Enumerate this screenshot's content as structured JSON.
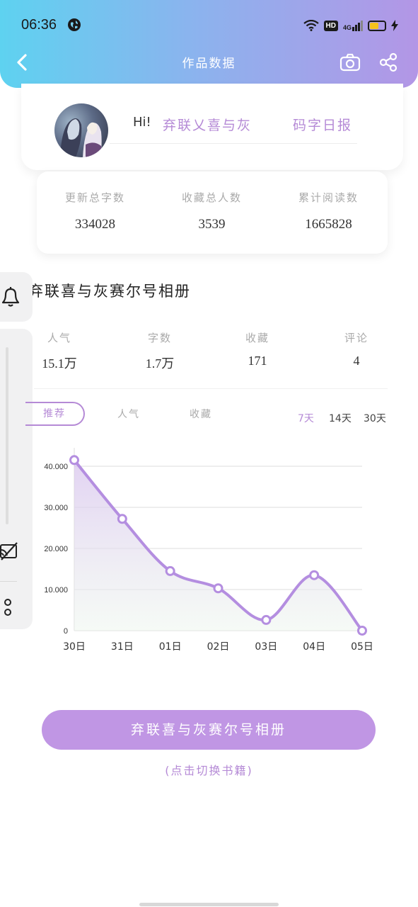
{
  "status_bar": {
    "time": "06:36",
    "hd_label": "HD",
    "network_label": "4G",
    "battery_level": 0.6,
    "battery_color": "#f5c31d"
  },
  "nav": {
    "title": "作品数据",
    "back_icon": "chevron-left-icon",
    "camera_icon": "camera-icon",
    "share_icon": "share-icon"
  },
  "profile": {
    "greeting": "Hi!",
    "author_name": "弃联乂喜与灰",
    "daily_report_link": "码字日报"
  },
  "summary": [
    {
      "label": "更新总字数",
      "value": "334028"
    },
    {
      "label": "收藏总人数",
      "value": "3539"
    },
    {
      "label": "累计阅读数",
      "value": "1665828"
    }
  ],
  "book": {
    "title": "弃联喜与灰赛尔号相册",
    "metrics": [
      {
        "label": "人气",
        "value": "15.1万"
      },
      {
        "label": "字数",
        "value": "1.7万"
      },
      {
        "label": "收藏",
        "value": "171"
      },
      {
        "label": "评论",
        "value": "4"
      }
    ]
  },
  "tabs": [
    {
      "label": "推荐",
      "active": true
    },
    {
      "label": "人气",
      "active": false
    },
    {
      "label": "收藏",
      "active": false
    }
  ],
  "ranges": [
    {
      "label": "7天",
      "active": true
    },
    {
      "label": "14天",
      "active": false
    },
    {
      "label": "30天",
      "active": false
    }
  ],
  "chart_data": {
    "type": "line",
    "categories": [
      "30日",
      "31日",
      "01日",
      "02日",
      "03日",
      "04日",
      "05日"
    ],
    "values": [
      41500,
      27200,
      14500,
      10300,
      2600,
      13500,
      0
    ],
    "y_ticks": [
      "0",
      "10.000",
      "20.000",
      "30.000",
      "40.000"
    ],
    "ylim": [
      0,
      40000
    ],
    "grid": true,
    "line_color": "#b48ee0"
  },
  "switch_button": {
    "label": "弃联喜与灰赛尔号相册",
    "hint": "(点击切换书籍)"
  },
  "side_panel": {
    "bell_icon": "bell-icon",
    "cast_off_icon": "cast-off-icon",
    "more_icon": "more-icon"
  },
  "colors": {
    "accent": "#b58ad6",
    "header_gradient_start": "#5ed2f0",
    "header_gradient_end": "#b396e6"
  }
}
